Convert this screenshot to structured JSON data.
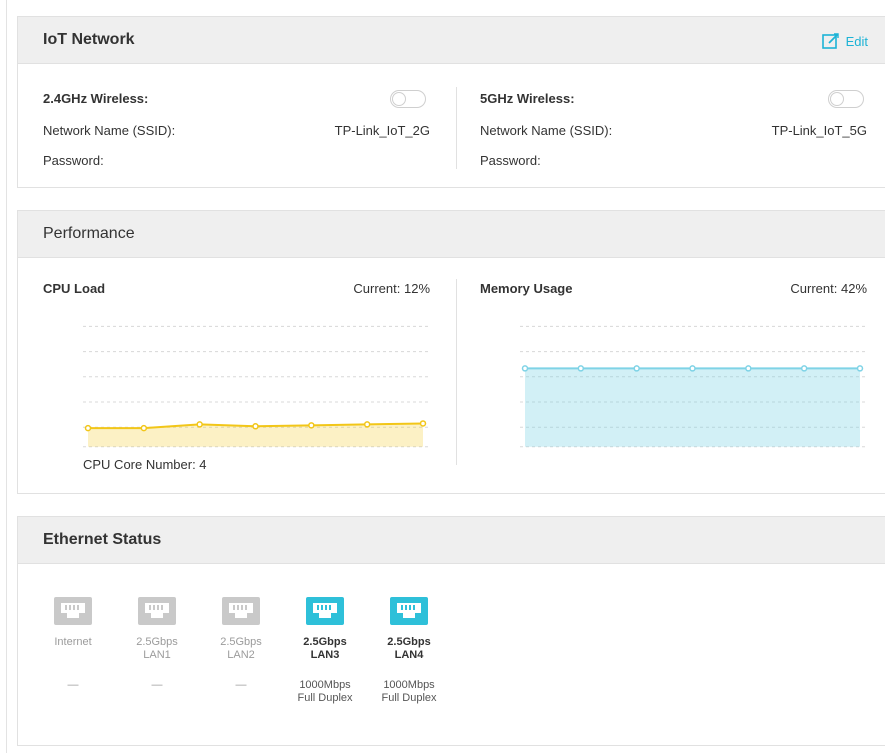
{
  "iot": {
    "title": "IoT Network",
    "edit_label": "Edit",
    "band24": {
      "label": "2.4GHz Wireless:",
      "enabled": false,
      "ssid_label": "Network Name (SSID):",
      "ssid": "TP-Link_IoT_2G",
      "password_label": "Password:"
    },
    "band5": {
      "label": "5GHz Wireless:",
      "enabled": false,
      "ssid_label": "Network Name (SSID):",
      "ssid": "TP-Link_IoT_5G",
      "password_label": "Password:"
    }
  },
  "performance": {
    "title": "Performance",
    "cpu": {
      "label": "CPU Load",
      "current": "Current: 12%",
      "core_number": "CPU Core Number: 4",
      "color": "#f2c618",
      "history": [
        10,
        10,
        12,
        11,
        11.5,
        12,
        12.5
      ]
    },
    "memory": {
      "label": "Memory Usage",
      "current": "Current: 42%",
      "color": "#7fd3e6",
      "history": [
        42,
        42,
        42,
        42,
        42,
        42,
        42
      ]
    }
  },
  "ethernet": {
    "title": "Ethernet Status",
    "active_color": "#2ec0d9",
    "inactive_color": "#c9c9c9",
    "ports": [
      {
        "name": "Internet",
        "name2": "",
        "active": false,
        "status": "—",
        "status2": ""
      },
      {
        "name": "2.5Gbps",
        "name2": "LAN1",
        "active": false,
        "status": "—",
        "status2": ""
      },
      {
        "name": "2.5Gbps",
        "name2": "LAN2",
        "active": false,
        "status": "—",
        "status2": ""
      },
      {
        "name": "2.5Gbps",
        "name2": "LAN3",
        "active": true,
        "status": "1000Mbps",
        "status2": "Full Duplex"
      },
      {
        "name": "2.5Gbps",
        "name2": "LAN4",
        "active": true,
        "status": "1000Mbps",
        "status2": "Full Duplex"
      }
    ]
  }
}
